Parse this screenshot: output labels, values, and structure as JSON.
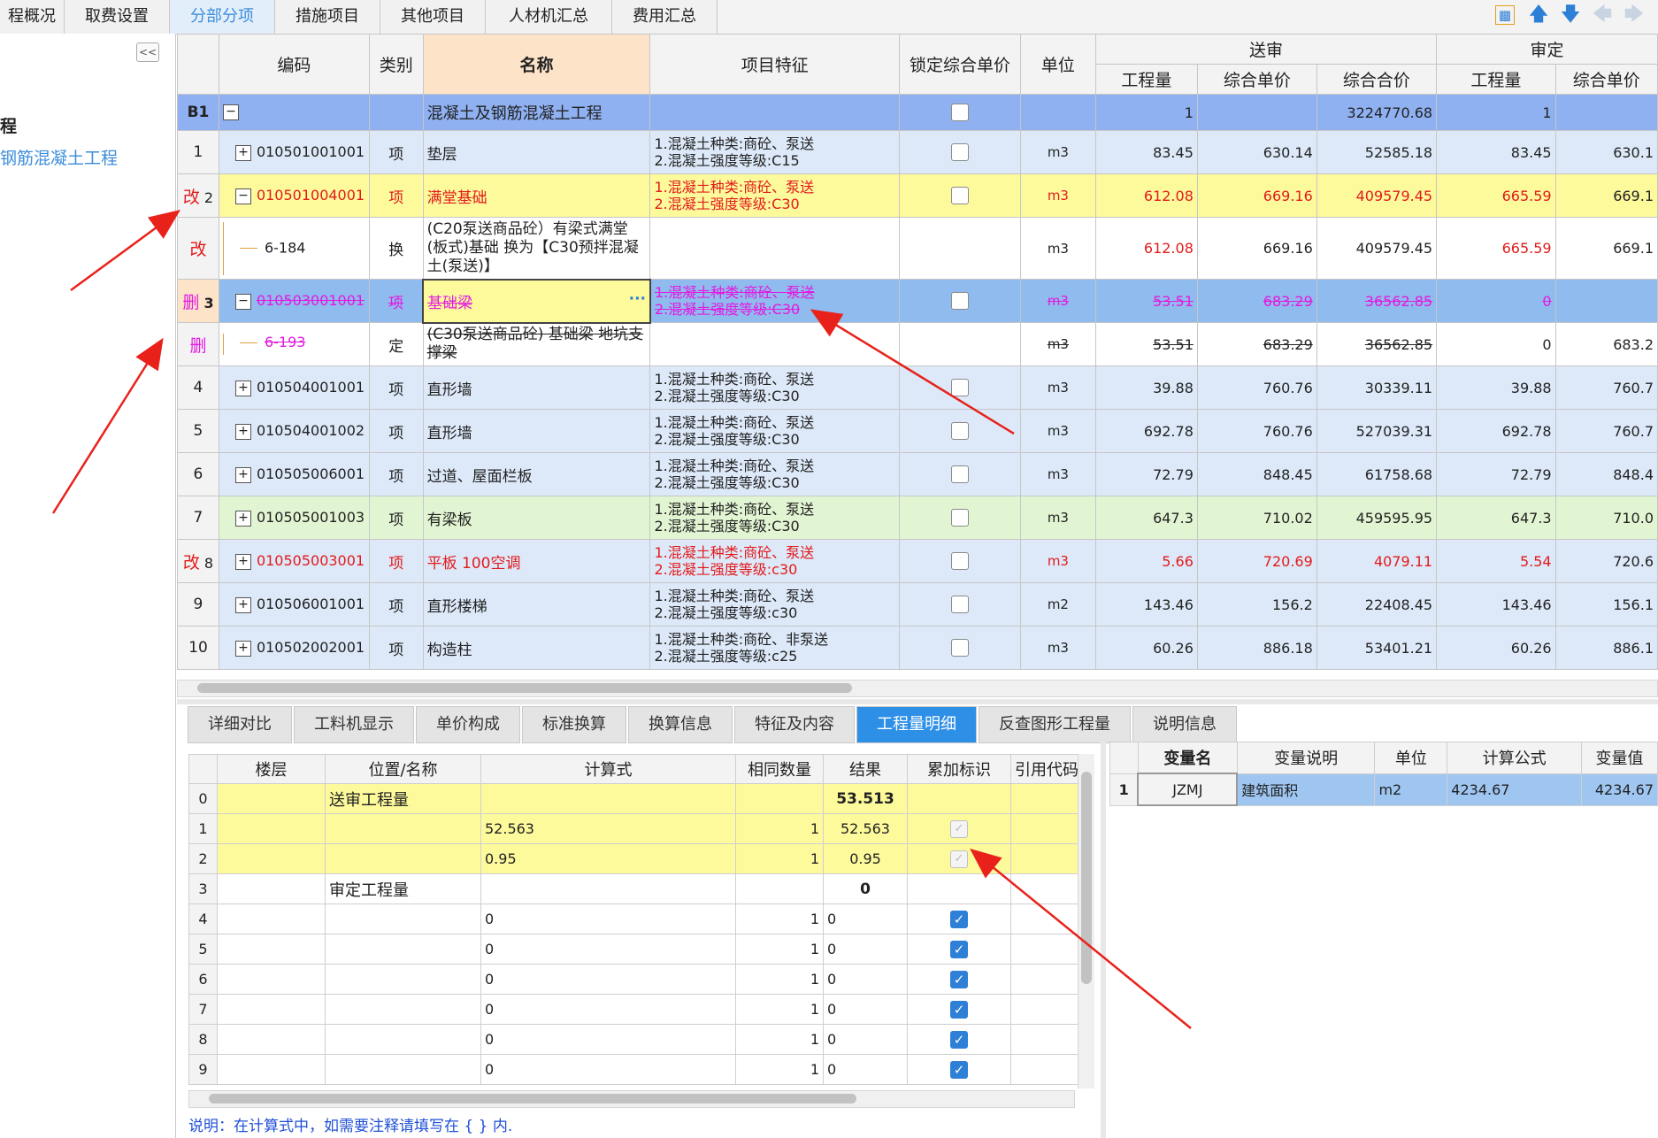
{
  "top_tabs": [
    "程概况",
    "取费设置",
    "分部分项",
    "措施项目",
    "其他项目",
    "人材机汇总",
    "费用汇总"
  ],
  "active_top_tab": "分部分项",
  "toolbar": {
    "icons": [
      "chart-icon",
      "arrow-up-icon",
      "arrow-down-icon",
      "arrow-left-icon",
      "arrow-right-icon"
    ]
  },
  "left_pane": {
    "collapse_label": "<<",
    "tree_items": [
      "程",
      "钢筋混凝土工程"
    ]
  },
  "main_grid": {
    "headers": {
      "code": "编码",
      "type": "类别",
      "name": "名称",
      "feature": "项目特征",
      "lock": "锁定综合单价",
      "unit": "单位",
      "group_songshen": "送审",
      "group_shending": "审定",
      "qty": "工程量",
      "uprice": "综合单价",
      "total": "综合合价",
      "qty2": "工程量",
      "uprice2": "综合单价"
    },
    "rows": [
      {
        "no": "B1",
        "mark": "",
        "code": "",
        "type": "",
        "name": "混凝土及钢筋混凝土工程",
        "feat1": "",
        "feat2": "",
        "unit": "",
        "qty": "1",
        "uprice": "",
        "total": "3224770.68",
        "qty2": "1",
        "uprice2": ""
      },
      {
        "no": "1",
        "mark": "",
        "code": "010501001001",
        "type": "项",
        "name": "垫层",
        "feat1": "1.混凝土种类:商砼、泵送",
        "feat2": "2.混凝土强度等级:C15",
        "unit": "m3",
        "qty": "83.45",
        "uprice": "630.14",
        "total": "52585.18",
        "qty2": "83.45",
        "uprice2": "630.1"
      },
      {
        "no": "2",
        "mark": "改",
        "code": "010501004001",
        "type": "项",
        "name": "满堂基础",
        "feat1": "1.混凝土种类:商砼、泵送",
        "feat2": "2.混凝土强度等级:C30",
        "unit": "m3",
        "qty": "612.08",
        "uprice": "669.16",
        "total": "409579.45",
        "qty2": "665.59",
        "uprice2": "669.1"
      },
      {
        "no": "",
        "mark": "改",
        "code": "6-184",
        "type": "换",
        "name": "(C20泵送商品砼）有梁式满堂(板式)基础  换为【C30预拌混凝土(泵送)】",
        "feat1": "",
        "feat2": "",
        "unit": "m3",
        "qty": "612.08",
        "uprice": "669.16",
        "total": "409579.45",
        "qty2": "665.59",
        "uprice2": "669.1"
      },
      {
        "no": "3",
        "mark": "删",
        "code": "010503001001",
        "type": "项",
        "name": "基础梁",
        "feat1": "1.混凝土种类:商砼、泵送",
        "feat2": "2.混凝土强度等级:C30",
        "unit": "m3",
        "qty": "53.51",
        "uprice": "683.29",
        "total": "36562.85",
        "qty2": "0",
        "uprice2": ""
      },
      {
        "no": "",
        "mark": "删",
        "code": "6-193",
        "type": "定",
        "name": "(C30泵送商品砼) 基础梁 地坑支撑梁",
        "feat1": "",
        "feat2": "",
        "unit": "m3",
        "qty": "53.51",
        "uprice": "683.29",
        "total": "36562.85",
        "qty2": "0",
        "uprice2": "683.2"
      },
      {
        "no": "4",
        "mark": "",
        "code": "010504001001",
        "type": "项",
        "name": "直形墙",
        "feat1": "1.混凝土种类:商砼、泵送",
        "feat2": "2.混凝土强度等级:C30",
        "unit": "m3",
        "qty": "39.88",
        "uprice": "760.76",
        "total": "30339.11",
        "qty2": "39.88",
        "uprice2": "760.7"
      },
      {
        "no": "5",
        "mark": "",
        "code": "010504001002",
        "type": "项",
        "name": "直形墙",
        "feat1": "1.混凝土种类:商砼、泵送",
        "feat2": "2.混凝土强度等级:C30",
        "unit": "m3",
        "qty": "692.78",
        "uprice": "760.76",
        "total": "527039.31",
        "qty2": "692.78",
        "uprice2": "760.7"
      },
      {
        "no": "6",
        "mark": "",
        "code": "010505006001",
        "type": "项",
        "name": "过道、屋面栏板",
        "feat1": "1.混凝土种类:商砼、泵送",
        "feat2": "2.混凝土强度等级:C30",
        "unit": "m3",
        "qty": "72.79",
        "uprice": "848.45",
        "total": "61758.68",
        "qty2": "72.79",
        "uprice2": "848.4"
      },
      {
        "no": "7",
        "mark": "",
        "code": "010505001003",
        "type": "项",
        "name": "有梁板",
        "feat1": "1.混凝土种类:商砼、泵送",
        "feat2": "2.混凝土强度等级:C30",
        "unit": "m3",
        "qty": "647.3",
        "uprice": "710.02",
        "total": "459595.95",
        "qty2": "647.3",
        "uprice2": "710.0"
      },
      {
        "no": "8",
        "mark": "改",
        "code": "010505003001",
        "type": "项",
        "name": "平板  100空调",
        "feat1": "1.混凝土种类:商砼、泵送",
        "feat2": "2.混凝土强度等级:c30",
        "unit": "m3",
        "qty": "5.66",
        "uprice": "720.69",
        "total": "4079.11",
        "qty2": "5.54",
        "uprice2": "720.6"
      },
      {
        "no": "9",
        "mark": "",
        "code": "010506001001",
        "type": "项",
        "name": "直形楼梯",
        "feat1": "1.混凝土种类:商砼、泵送",
        "feat2": "2.混凝土强度等级:c30",
        "unit": "m2",
        "qty": "143.46",
        "uprice": "156.2",
        "total": "22408.45",
        "qty2": "143.46",
        "uprice2": "156.1"
      },
      {
        "no": "10",
        "mark": "",
        "code": "010502002001",
        "type": "项",
        "name": "构造柱",
        "feat1": "1.混凝土种类:商砼、非泵送",
        "feat2": "2.混凝土强度等级:c25",
        "unit": "m3",
        "qty": "60.26",
        "uprice": "886.18",
        "total": "53401.21",
        "qty2": "60.26",
        "uprice2": "886.1"
      }
    ]
  },
  "bottom_tabs": [
    "详细对比",
    "工料机显示",
    "单价构成",
    "标准换算",
    "换算信息",
    "特征及内容",
    "工程量明细",
    "反查图形工程量",
    "说明信息"
  ],
  "active_bottom_tab": "工程量明细",
  "detail_grid": {
    "headers": {
      "floor": "楼层",
      "position": "位置/名称",
      "formula": "计算式",
      "same": "相同数量",
      "result": "结果",
      "accum": "累加标识",
      "ref": "引用代码"
    },
    "rows": [
      {
        "idx": "0",
        "position": "送审工程量",
        "formula": "",
        "same": "",
        "result": "53.513"
      },
      {
        "idx": "1",
        "position": "",
        "formula": "52.563",
        "same": "1",
        "result": "52.563"
      },
      {
        "idx": "2",
        "position": "",
        "formula": "0.95",
        "same": "1",
        "result": "0.95"
      },
      {
        "idx": "3",
        "position": "审定工程量",
        "formula": "",
        "same": "",
        "result": "0"
      },
      {
        "idx": "4",
        "position": "",
        "formula": "0",
        "same": "1",
        "result": "0"
      },
      {
        "idx": "5",
        "position": "",
        "formula": "0",
        "same": "1",
        "result": "0"
      },
      {
        "idx": "6",
        "position": "",
        "formula": "0",
        "same": "1",
        "result": "0"
      },
      {
        "idx": "7",
        "position": "",
        "formula": "0",
        "same": "1",
        "result": "0"
      },
      {
        "idx": "8",
        "position": "",
        "formula": "0",
        "same": "1",
        "result": "0"
      },
      {
        "idx": "9",
        "position": "",
        "formula": "0",
        "same": "1",
        "result": "0"
      }
    ]
  },
  "var_grid": {
    "headers": {
      "name": "变量名",
      "desc": "变量说明",
      "unit": "单位",
      "formula": "计算公式",
      "value": "变量值"
    },
    "rows": [
      {
        "idx": "1",
        "name": "JZMJ",
        "desc": "建筑面积",
        "unit": "m2",
        "formula": "4234.67",
        "value": "4234.67"
      }
    ]
  },
  "note": "说明：在计算式中，如需要注释请填写在 { } 内.",
  "colors": {
    "accent": "#2e8fe6",
    "changed": "#e21b1b",
    "deleted": "#e21be0",
    "arrow": "#e8221b"
  }
}
